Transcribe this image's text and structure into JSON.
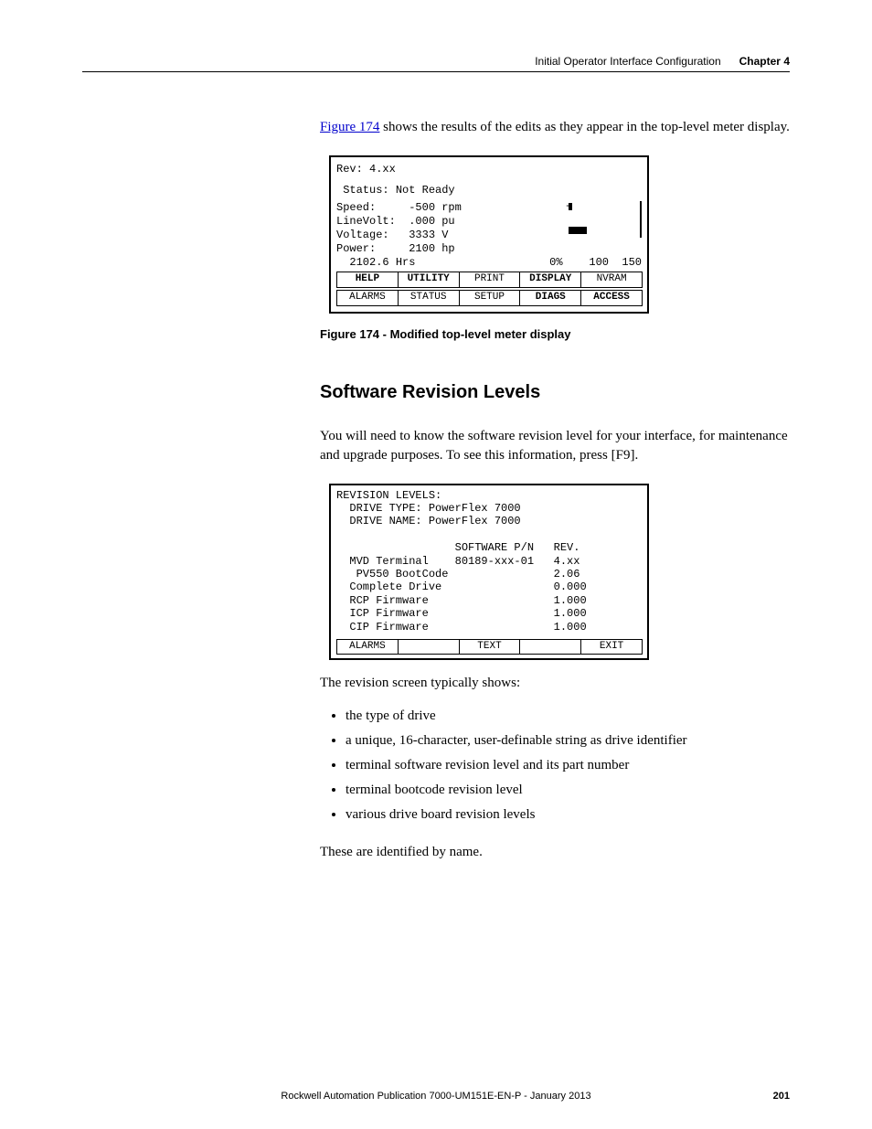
{
  "header": {
    "section": "Initial Operator Interface Configuration",
    "chapter": "Chapter 4"
  },
  "intro_para": {
    "link_text": "Figure 174",
    "rest": " shows the results of the edits as they appear in the top-level meter display."
  },
  "lcd1": {
    "rev": "Rev: 4.xx",
    "status": "Status: Not Ready",
    "meters": [
      {
        "label": "Speed:",
        "val": "-500",
        "unit": "rpm"
      },
      {
        "label": "LineVolt:",
        "val": ".000",
        "unit": "pu"
      },
      {
        "label": "Voltage:",
        "val": "3333",
        "unit": "V"
      },
      {
        "label": "Power:",
        "val": "2100",
        "unit": "hp"
      }
    ],
    "hrs": "2102.6 Hrs",
    "scale": {
      "pct": "0%",
      "mid": "100",
      "max": "150"
    },
    "fkeys_row1": [
      "HELP",
      "UTILITY",
      "PRINT",
      "DISPLAY",
      "NVRAM"
    ],
    "fkeys_row2": [
      "ALARMS",
      "STATUS",
      "SETUP",
      "DIAGS",
      "ACCESS"
    ],
    "bold_cells": [
      "HELP",
      "UTILITY",
      "DISPLAY",
      "DIAGS",
      "ACCESS"
    ]
  },
  "fig_caption": "Figure 174 - Modified top-level meter display",
  "section_title": "Software Revision Levels",
  "section_para": "You will need to know the software revision level for your interface, for maintenance and upgrade purposes. To see this information, press [F9].",
  "rev_screen": {
    "title": "REVISION LEVELS:",
    "lines": [
      "  DRIVE TYPE: PowerFlex 7000",
      "  DRIVE NAME: PowerFlex 7000",
      "",
      "                  SOFTWARE P/N   REV.",
      "  MVD Terminal    80189-xxx-01   4.xx",
      "   PV550 BootCode                2.06",
      "  Complete Drive                 0.000",
      "  RCP Firmware                   1.000",
      "  ICP Firmware                   1.000",
      "  CIP Firmware                   1.000"
    ],
    "fkeys": [
      "ALARMS",
      "",
      "TEXT",
      "",
      "EXIT"
    ]
  },
  "list_intro": "The revision screen typically shows:",
  "bullets": [
    "the type of drive",
    "a unique, 16-character, user-definable string as drive identifier",
    "terminal software revision level and its part number",
    "terminal bootcode revision level",
    "various drive board revision levels"
  ],
  "closing": "These are identified by name.",
  "footer": {
    "pub": "Rockwell Automation Publication 7000-UM151E-EN-P - January 2013",
    "page": "201"
  }
}
